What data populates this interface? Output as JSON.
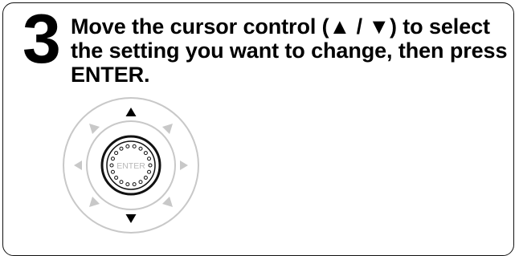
{
  "step": {
    "number": "3",
    "instruction": "Move the cursor control (▲ / ▼) to select the setting you want to change, then press ENTER."
  },
  "control": {
    "center_label": "ENTER",
    "highlighted_arrows": [
      "up-arrow-icon",
      "down-arrow-icon"
    ],
    "colors": {
      "active": "#000000",
      "inactive": "#c8c8c8",
      "ring": "#c8c8c8"
    }
  }
}
